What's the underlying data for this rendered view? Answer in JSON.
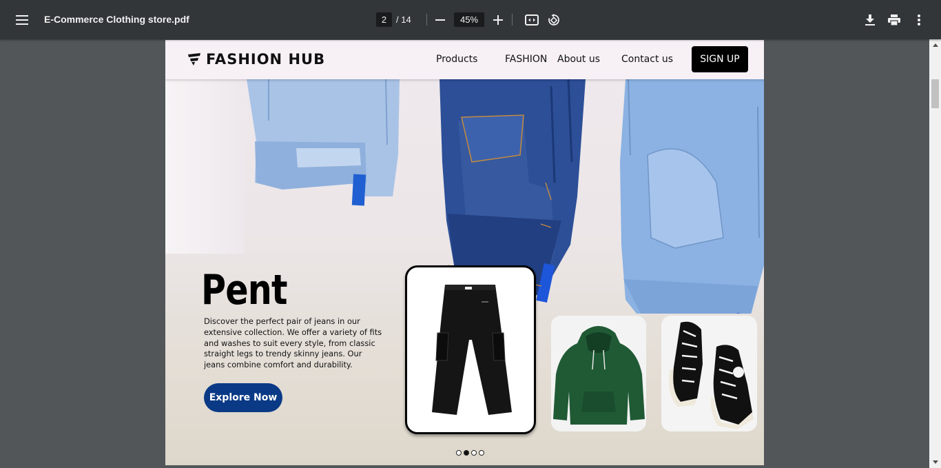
{
  "viewer": {
    "file_name": "E-Commerce Clothing store.pdf",
    "current_page": "2",
    "total_pages": "/ 14",
    "zoom": "45%",
    "icons": [
      "menu-icon",
      "minus-icon",
      "plus-icon",
      "fit-page-icon",
      "rotate-icon",
      "download-icon",
      "print-icon",
      "more-vert-icon"
    ]
  },
  "site": {
    "brand": "FASHION HUB",
    "nav": {
      "products": "Products",
      "fashion": "FASHION",
      "about": "About us",
      "contact": "Contact us",
      "signup": "SIGN UP"
    },
    "hero": {
      "title": "Pent",
      "description": "Discover the perfect pair of jeans in our extensive collection. We offer a variety of fits and washes to suit every style, from classic straight legs to trendy skinny jeans. Our jeans combine comfort and durability.",
      "cta": "Explore Now"
    },
    "carousel": {
      "slides": 4,
      "active_index": 2
    },
    "colors": {
      "cta_blue": "#0a3a86",
      "signup_bg": "#000000",
      "nav_bg": "#f7f1f6"
    }
  }
}
